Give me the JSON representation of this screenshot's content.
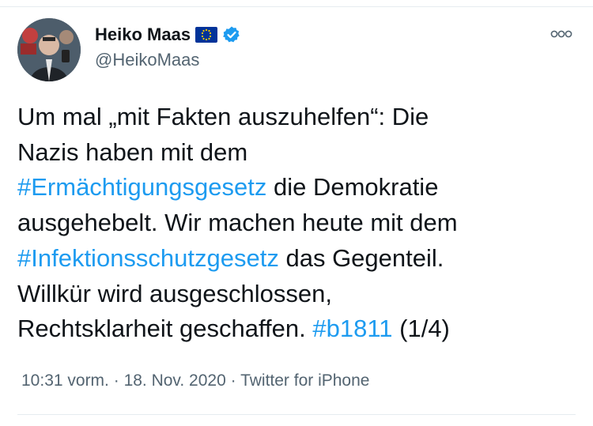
{
  "author": {
    "name": "Heiko Maas",
    "handle": "@HeikoMaas",
    "flag_icon": "eu-flag-icon",
    "verified_icon": "verified-badge-icon",
    "avatar_icon": "profile-photo"
  },
  "menu": {
    "icon": "more-options-icon"
  },
  "tweet": {
    "lines": [
      [
        {
          "text": "Um mal „mit Fakten auszuhelfen“: Die",
          "link": false
        }
      ],
      [
        {
          "text": "Nazis haben mit dem",
          "link": false
        }
      ],
      [
        {
          "text": "#Ermächtigungsgesetz",
          "link": true
        },
        {
          "text": " die Demokratie",
          "link": false
        }
      ],
      [
        {
          "text": "ausgehebelt. Wir machen heute mit dem",
          "link": false
        }
      ],
      [
        {
          "text": "#Infektionsschutzgesetz",
          "link": true
        },
        {
          "text": " das Gegenteil.",
          "link": false
        }
      ],
      [
        {
          "text": "Willkür wird ausgeschlossen,",
          "link": false
        }
      ],
      [
        {
          "text": "Rechtsklarheit geschaffen. ",
          "link": false
        },
        {
          "text": "#b1811",
          "link": true
        },
        {
          "text": " (1/4)",
          "link": false
        }
      ]
    ]
  },
  "meta": {
    "time": "10:31 vorm.",
    "separator": " · ",
    "date": "18. Nov. 2020",
    "source": "Twitter for iPhone"
  },
  "colors": {
    "link": "#1d9bf0",
    "verified": "#1d9bf0",
    "eu_flag": "#003399",
    "muted": "#536471"
  }
}
